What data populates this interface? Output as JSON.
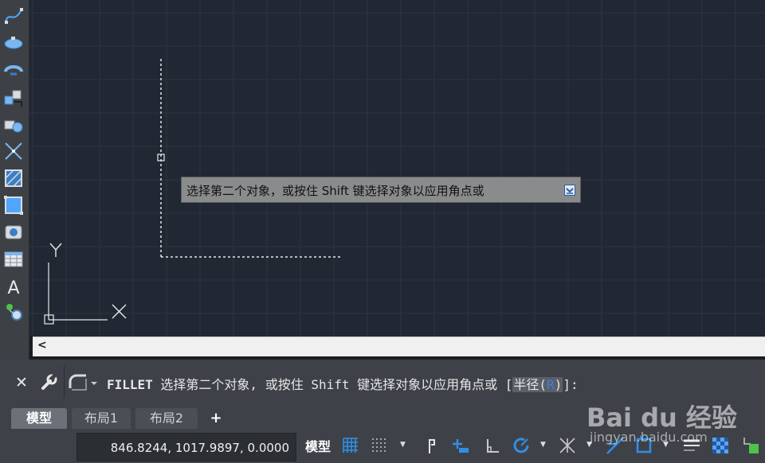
{
  "toolbar": {
    "tools": [
      "spline-icon",
      "ellipse-icon",
      "ellipse-arc-icon",
      "insert-block-icon",
      "create-block-icon",
      "point-icon",
      "hatch-icon",
      "gradient-icon",
      "region-icon",
      "table-icon",
      "multiline-text-icon",
      "add-selected-icon"
    ],
    "text_tool_glyph": "A"
  },
  "canvas": {
    "background": "#212833",
    "grid_color": "#2d3440",
    "ucs": {
      "x_label": "X",
      "y_label": "Y"
    }
  },
  "tooltip": {
    "text": "选择第二个对象，或按住 Shift 键选择对象以应用角点或"
  },
  "hscroll": {
    "left_arrow": "<"
  },
  "command": {
    "close_glyph": "✕",
    "keyword": "FILLET",
    "prompt": " 选择第二个对象, 或按住 Shift 键选择对象以应用角点或 [",
    "option_prefix": "半径(",
    "option_key": "R",
    "option_suffix": ")",
    "end": "]:"
  },
  "tabs": {
    "model": "模型",
    "layout1": "布局1",
    "layout2": "布局2",
    "add": "+"
  },
  "status": {
    "coordinates": "846.8244, 1017.9897, 0.0000",
    "model_label": "模型",
    "icons": [
      "grid-icon",
      "snap-icon",
      "infer-constraints-icon",
      "dynamic-input-icon",
      "ortho-icon",
      "polar-tracking-icon",
      "isometric-icon",
      "object-snap-tracking-icon",
      "object-snap-icon",
      "lineweight-icon",
      "transparency-icon",
      "selection-cycling-icon"
    ],
    "accent": "#2f8fe8"
  },
  "watermark": {
    "logo": "Bai du 经验",
    "url": "jingyan.baidu.com"
  }
}
